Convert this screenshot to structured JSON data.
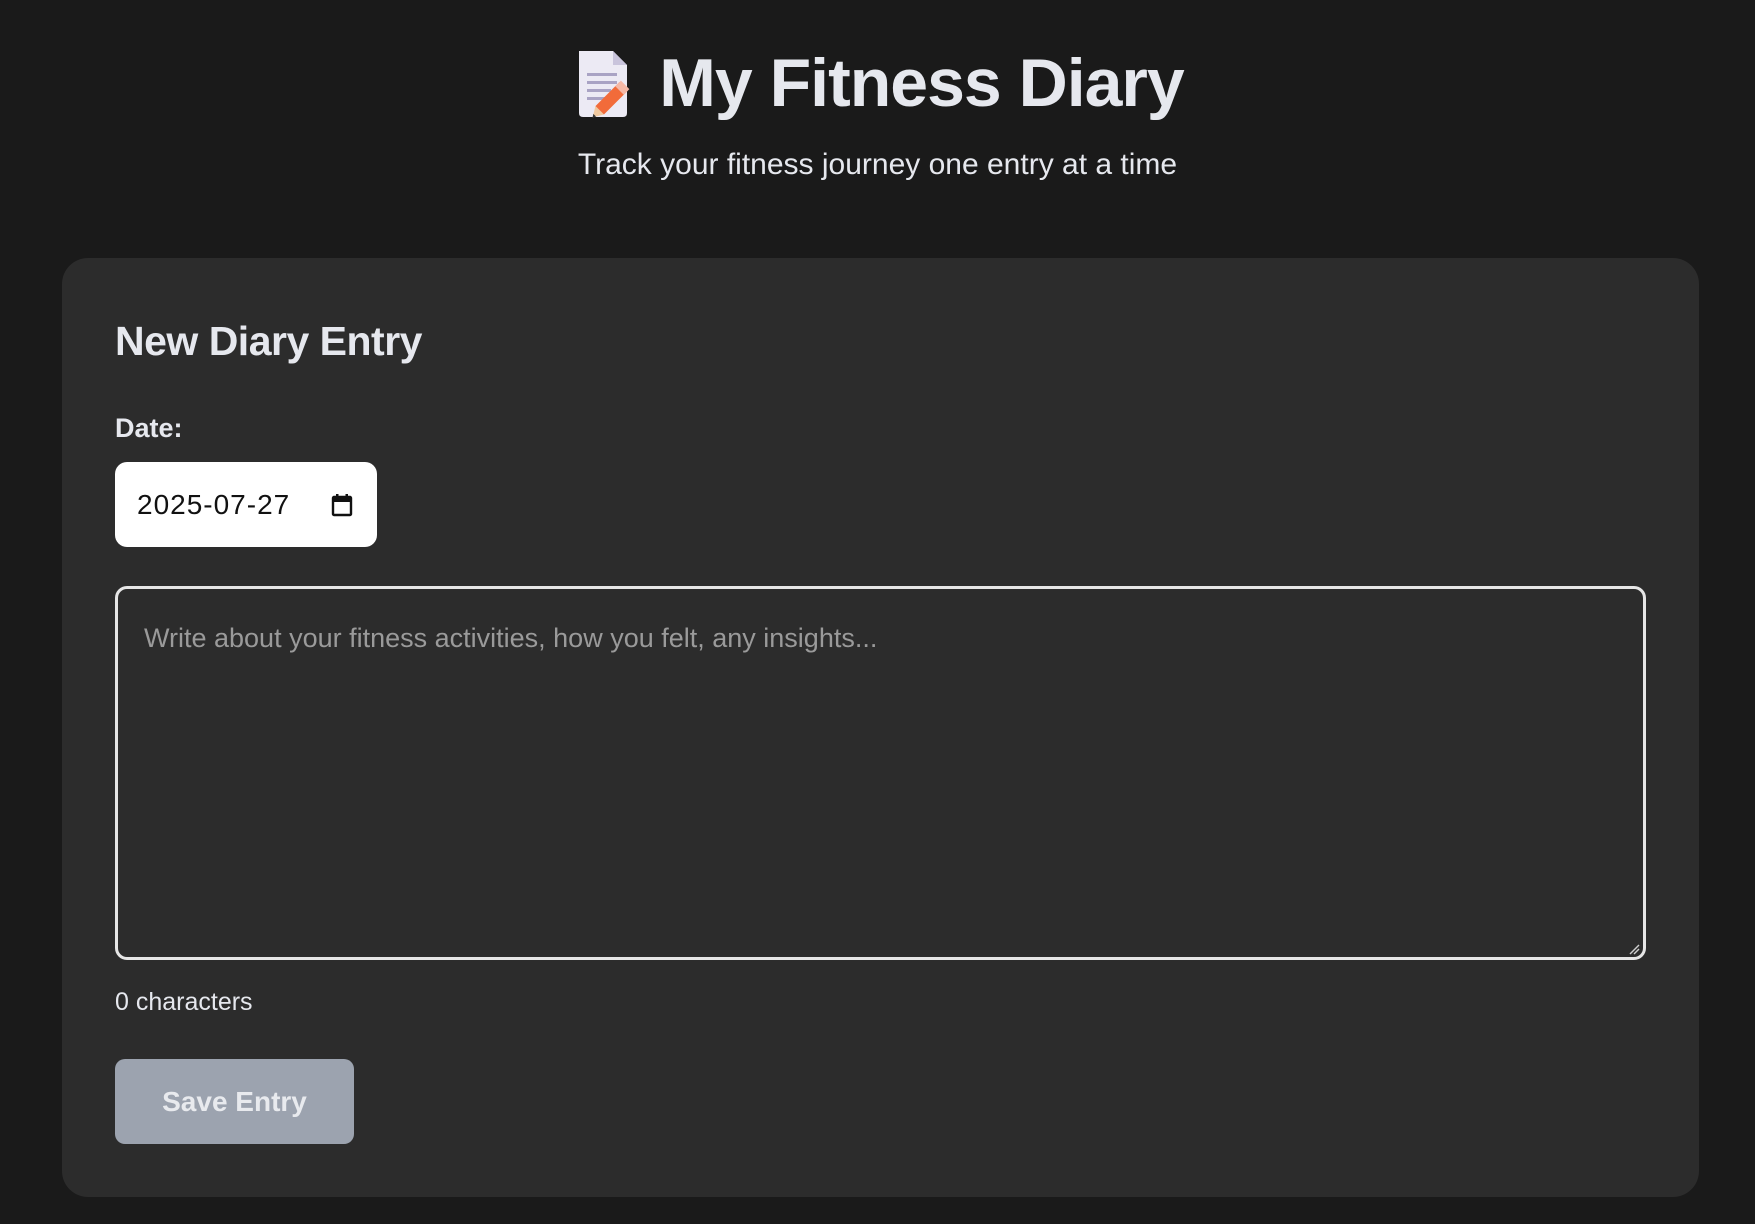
{
  "header": {
    "icon": "memo-pencil-icon",
    "title": "My Fitness Diary",
    "subtitle": "Track your fitness journey one entry at a time"
  },
  "entry_form": {
    "heading": "New Diary Entry",
    "date_label": "Date:",
    "date_value": "2025-07-27",
    "date_icon": "calendar-icon",
    "textarea_placeholder": "Write about your fitness activities, how you felt, any insights...",
    "textarea_value": "",
    "char_count": "0 characters",
    "save_label": "Save Entry"
  },
  "colors": {
    "background": "#1a1a1a",
    "card": "#2c2c2c",
    "text": "#e6e8ee",
    "button_disabled": "#9ca3af",
    "placeholder": "#9a9a9a"
  }
}
